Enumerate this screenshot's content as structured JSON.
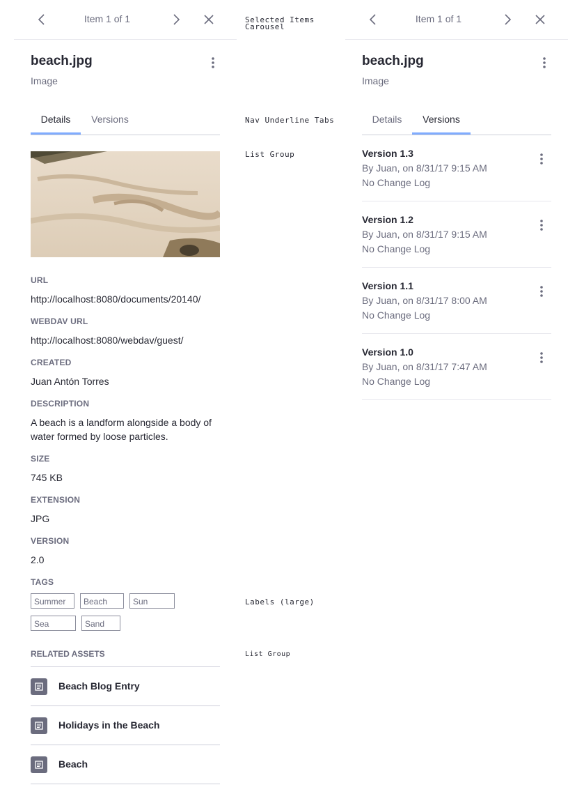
{
  "left_panel": {
    "carousel": {
      "counter": "Item 1 of 1"
    },
    "title": "beach.jpg",
    "subtitle": "Image",
    "tabs": [
      {
        "label": "Details",
        "active": true
      },
      {
        "label": "Versions",
        "active": false
      }
    ],
    "fields": [
      {
        "label": "URL",
        "value": "http://localhost:8080/documents/20140/"
      },
      {
        "label": "WEBDAV URL",
        "value": "http://localhost:8080/webdav/guest/"
      },
      {
        "label": "CREATED",
        "value": "Juan Antón Torres"
      },
      {
        "label": "DESCRIPTION",
        "value": "A beach is a landform alongside a body of water formed by loose particles."
      },
      {
        "label": "SIZE",
        "value": "745 KB"
      },
      {
        "label": "EXTENSION",
        "value": "JPG"
      },
      {
        "label": "VERSION",
        "value": "2.0"
      }
    ],
    "tags_label": "TAGS",
    "tags": [
      "Summer",
      "Beach",
      "Sun",
      "Sea",
      "Sand"
    ],
    "related_label": "RELATED ASSETS",
    "related": [
      {
        "name": "Beach Blog Entry",
        "icon": "document-icon"
      },
      {
        "name": "Holidays in the Beach",
        "icon": "document-icon"
      },
      {
        "name": "Beach",
        "icon": "document-icon"
      }
    ]
  },
  "right_panel": {
    "carousel": {
      "counter": "Item 1 of 1"
    },
    "title": "beach.jpg",
    "subtitle": "Image",
    "tabs": [
      {
        "label": "Details",
        "active": false
      },
      {
        "label": "Versions",
        "active": true
      }
    ],
    "versions": [
      {
        "title": "Version 1.3",
        "by": "By Juan, on 8/31/17 9:15 AM",
        "log": "No Change Log"
      },
      {
        "title": "Version 1.2",
        "by": "By Juan, on 8/31/17 9:15 AM",
        "log": "No Change Log"
      },
      {
        "title": "Version 1.1",
        "by": "By Juan, on 8/31/17 8:00 AM",
        "log": "No Change Log"
      },
      {
        "title": "Version 1.0",
        "by": "By Juan, on 8/31/17 7:47 AM",
        "log": "No Change Log"
      }
    ]
  },
  "doc_labels": {
    "carousel_line1": "Selected Items",
    "carousel_line2": "Carousel",
    "tabs": "Nav Underline Tabs",
    "list_group": "List Group",
    "labels_large": "Labels (large)",
    "list_group_2": "List Group"
  },
  "colors": {
    "accent": "#80acff",
    "text": "#272833",
    "secondary": "#6b6c7e",
    "border": "#cdced9"
  }
}
